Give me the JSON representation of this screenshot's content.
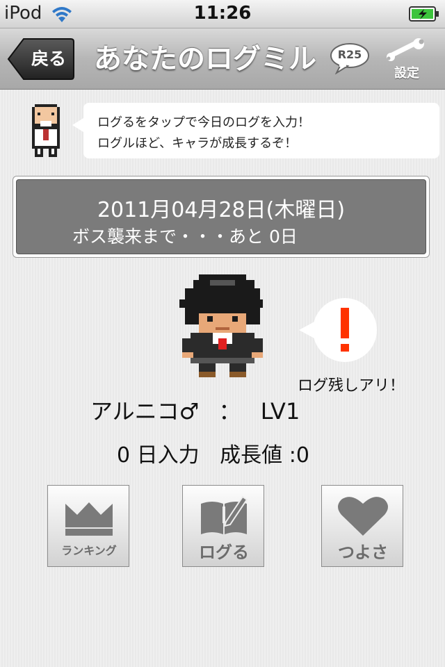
{
  "status_bar": {
    "carrier": "iPod",
    "time": "11:26",
    "wifi_icon": "wifi-icon",
    "battery_icon": "battery-charging-icon"
  },
  "nav": {
    "back_label": "戻る",
    "title": "あなたのログミル",
    "r25_label": "R25",
    "settings_label": "設定",
    "settings_icon": "wrench-icon"
  },
  "tip": {
    "line1": "ログるをタップで今日のログを入力！",
    "line2": "ログルほど、キャラが成長するぞ！"
  },
  "date_panel": {
    "date": "2011月04月28日(木曜日)",
    "boss_countdown": "ボス襲来まで・・・あと 0日"
  },
  "character": {
    "alert_icon": "exclamation-icon",
    "log_status": "ログ残しアリ！",
    "name": "アルニコ♂",
    "separator": "：",
    "level": "LV1",
    "days_input": "0 日入力",
    "growth": "成長値 :0"
  },
  "menu": {
    "ranking_label": "ランキング",
    "ranking_icon": "crown-icon",
    "log_label": "ログる",
    "log_icon": "notebook-pen-icon",
    "strength_label": "つよさ",
    "strength_icon": "heart-icon"
  },
  "colors": {
    "alert_red": "#ff3300",
    "date_panel_bg": "#7b7b7b",
    "nav_bg": "#b6b6b6",
    "back_button_bg": "#3a3a3a",
    "icon_gray": "#7a7a7a"
  }
}
